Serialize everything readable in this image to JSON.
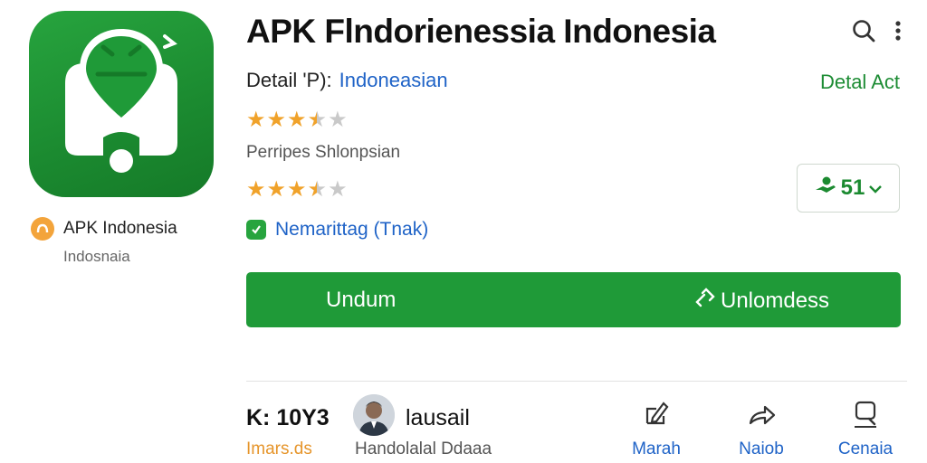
{
  "app": {
    "title": "APK Flndorienessia Indonesia",
    "detail_label": "Detail 'P):",
    "detail_value": "Indoneasian",
    "detail_act": "Detal Act",
    "subtitle": "Perripes Shlonpsian",
    "feature_label": "Nemarittag (Tnak)",
    "price": "51",
    "icon_name": "map-pin-app-icon",
    "rating_1": 3.5,
    "rating_2": 3.5
  },
  "developer": {
    "name": "APK Indonesia",
    "sub": "Indosnaia"
  },
  "download": {
    "left_label": "Undum",
    "right_label": "Unlomdess"
  },
  "stats": {
    "main": "K: 10Y3",
    "sub": "Imars.ds"
  },
  "user": {
    "name": "lausail",
    "sub": "Handolalal Ddaaa"
  },
  "actions": [
    {
      "label": "Marah",
      "icon": "edit-icon"
    },
    {
      "label": "Naiob",
      "icon": "share-icon"
    },
    {
      "label": "Cenaia",
      "icon": "search-icon"
    }
  ],
  "colors": {
    "brand_green": "#1f9a38",
    "link_blue": "#1f63c7",
    "star_orange": "#f0a22a",
    "accent_orange": "#e6952b"
  }
}
